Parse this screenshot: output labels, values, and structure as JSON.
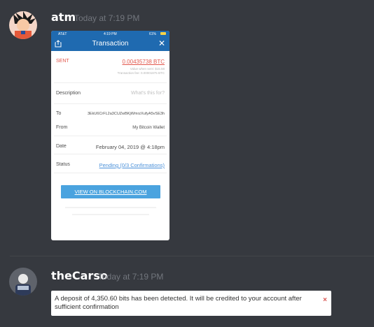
{
  "messages": [
    {
      "username": "atm",
      "timestamp": "Today at 7:19 PM",
      "attachment": {
        "status_bar": {
          "carrier": "AT&T",
          "time": "4:19 PM",
          "battery": "61%"
        },
        "title": "Transaction",
        "sent_label": "SENT",
        "sent_amount": "0.00435738 BTC",
        "value_line": "Value when sent: $15.58",
        "fee_line": "Transaction fee: 0.00001875 BTC",
        "description_label": "Description",
        "description_placeholder": "What's this for?",
        "to_label": "To",
        "to_value": "3EkU6CrFL2a3CUZwBKjWmrzXufyA5vSE3h",
        "from_label": "From",
        "from_value": "My Bitcoin Wallet",
        "date_label": "Date",
        "date_value": "February 04, 2019 @ 4:18pm",
        "status_label": "Status",
        "status_value": "Pending (0/3 Confirmations)",
        "button_label": "VIEW ON BLOCKCHAIN.COM"
      }
    },
    {
      "username": "theCarso",
      "timestamp": "Today at 7:19 PM",
      "bot_text": "A deposit of 4,350.60 bits has been detected. It will be credited to your account after sufficient confirmation",
      "bot_close": "×"
    }
  ],
  "colors": {
    "background": "#36393f",
    "wallet_blue": "#1f6ab0",
    "sent_red": "#e2574c",
    "link_blue": "#4a90d9",
    "button_blue": "#4aa3df"
  },
  "icons": [
    "share-icon",
    "close-icon",
    "wifi-icon",
    "battery-icon"
  ]
}
